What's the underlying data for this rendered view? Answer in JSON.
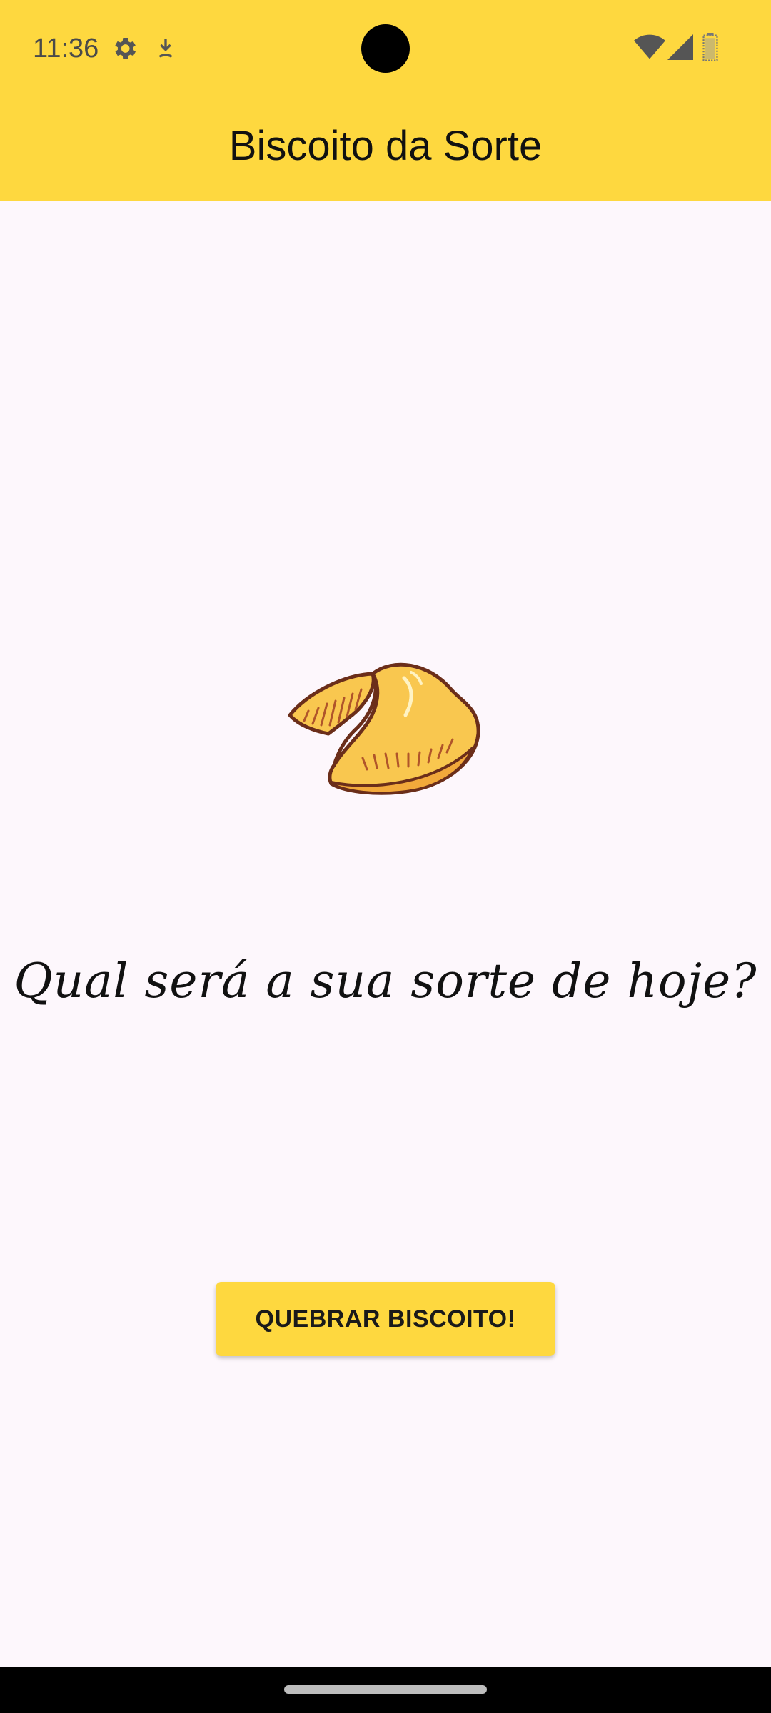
{
  "status_bar": {
    "time": "11:36",
    "icons": [
      "settings-gear-icon",
      "download-indicator-icon",
      "wifi-icon",
      "cell-signal-icon",
      "battery-icon"
    ]
  },
  "app_bar": {
    "title": "Biscoito da Sorte"
  },
  "main": {
    "image_icon": "fortune-cookie-icon",
    "prompt": "Qual será a sua sorte de hoje?",
    "button_label": "QUEBRAR BISCOITO!"
  },
  "colors": {
    "accent": "#FED83F",
    "background": "#FDF7FC",
    "cookie_fill": "#F9C74F",
    "cookie_outline": "#6B2E1A"
  }
}
